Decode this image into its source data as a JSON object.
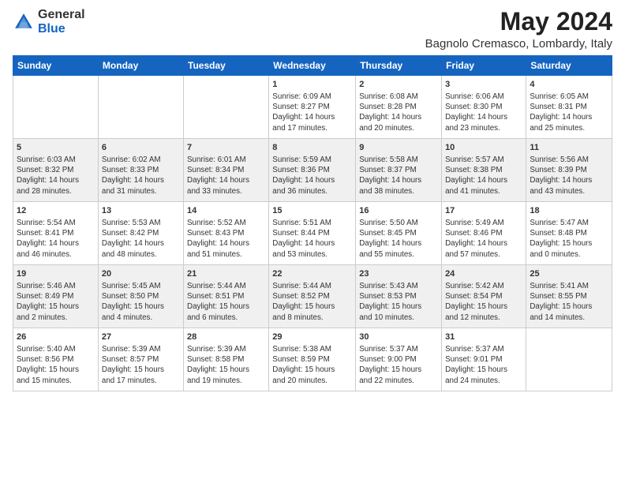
{
  "header": {
    "logo_general": "General",
    "logo_blue": "Blue",
    "month_title": "May 2024",
    "location": "Bagnolo Cremasco, Lombardy, Italy"
  },
  "days_of_week": [
    "Sunday",
    "Monday",
    "Tuesday",
    "Wednesday",
    "Thursday",
    "Friday",
    "Saturday"
  ],
  "weeks": [
    [
      {
        "num": "",
        "info": ""
      },
      {
        "num": "",
        "info": ""
      },
      {
        "num": "",
        "info": ""
      },
      {
        "num": "1",
        "info": "Sunrise: 6:09 AM\nSunset: 8:27 PM\nDaylight: 14 hours\nand 17 minutes."
      },
      {
        "num": "2",
        "info": "Sunrise: 6:08 AM\nSunset: 8:28 PM\nDaylight: 14 hours\nand 20 minutes."
      },
      {
        "num": "3",
        "info": "Sunrise: 6:06 AM\nSunset: 8:30 PM\nDaylight: 14 hours\nand 23 minutes."
      },
      {
        "num": "4",
        "info": "Sunrise: 6:05 AM\nSunset: 8:31 PM\nDaylight: 14 hours\nand 25 minutes."
      }
    ],
    [
      {
        "num": "5",
        "info": "Sunrise: 6:03 AM\nSunset: 8:32 PM\nDaylight: 14 hours\nand 28 minutes."
      },
      {
        "num": "6",
        "info": "Sunrise: 6:02 AM\nSunset: 8:33 PM\nDaylight: 14 hours\nand 31 minutes."
      },
      {
        "num": "7",
        "info": "Sunrise: 6:01 AM\nSunset: 8:34 PM\nDaylight: 14 hours\nand 33 minutes."
      },
      {
        "num": "8",
        "info": "Sunrise: 5:59 AM\nSunset: 8:36 PM\nDaylight: 14 hours\nand 36 minutes."
      },
      {
        "num": "9",
        "info": "Sunrise: 5:58 AM\nSunset: 8:37 PM\nDaylight: 14 hours\nand 38 minutes."
      },
      {
        "num": "10",
        "info": "Sunrise: 5:57 AM\nSunset: 8:38 PM\nDaylight: 14 hours\nand 41 minutes."
      },
      {
        "num": "11",
        "info": "Sunrise: 5:56 AM\nSunset: 8:39 PM\nDaylight: 14 hours\nand 43 minutes."
      }
    ],
    [
      {
        "num": "12",
        "info": "Sunrise: 5:54 AM\nSunset: 8:41 PM\nDaylight: 14 hours\nand 46 minutes."
      },
      {
        "num": "13",
        "info": "Sunrise: 5:53 AM\nSunset: 8:42 PM\nDaylight: 14 hours\nand 48 minutes."
      },
      {
        "num": "14",
        "info": "Sunrise: 5:52 AM\nSunset: 8:43 PM\nDaylight: 14 hours\nand 51 minutes."
      },
      {
        "num": "15",
        "info": "Sunrise: 5:51 AM\nSunset: 8:44 PM\nDaylight: 14 hours\nand 53 minutes."
      },
      {
        "num": "16",
        "info": "Sunrise: 5:50 AM\nSunset: 8:45 PM\nDaylight: 14 hours\nand 55 minutes."
      },
      {
        "num": "17",
        "info": "Sunrise: 5:49 AM\nSunset: 8:46 PM\nDaylight: 14 hours\nand 57 minutes."
      },
      {
        "num": "18",
        "info": "Sunrise: 5:47 AM\nSunset: 8:48 PM\nDaylight: 15 hours\nand 0 minutes."
      }
    ],
    [
      {
        "num": "19",
        "info": "Sunrise: 5:46 AM\nSunset: 8:49 PM\nDaylight: 15 hours\nand 2 minutes."
      },
      {
        "num": "20",
        "info": "Sunrise: 5:45 AM\nSunset: 8:50 PM\nDaylight: 15 hours\nand 4 minutes."
      },
      {
        "num": "21",
        "info": "Sunrise: 5:44 AM\nSunset: 8:51 PM\nDaylight: 15 hours\nand 6 minutes."
      },
      {
        "num": "22",
        "info": "Sunrise: 5:44 AM\nSunset: 8:52 PM\nDaylight: 15 hours\nand 8 minutes."
      },
      {
        "num": "23",
        "info": "Sunrise: 5:43 AM\nSunset: 8:53 PM\nDaylight: 15 hours\nand 10 minutes."
      },
      {
        "num": "24",
        "info": "Sunrise: 5:42 AM\nSunset: 8:54 PM\nDaylight: 15 hours\nand 12 minutes."
      },
      {
        "num": "25",
        "info": "Sunrise: 5:41 AM\nSunset: 8:55 PM\nDaylight: 15 hours\nand 14 minutes."
      }
    ],
    [
      {
        "num": "26",
        "info": "Sunrise: 5:40 AM\nSunset: 8:56 PM\nDaylight: 15 hours\nand 15 minutes."
      },
      {
        "num": "27",
        "info": "Sunrise: 5:39 AM\nSunset: 8:57 PM\nDaylight: 15 hours\nand 17 minutes."
      },
      {
        "num": "28",
        "info": "Sunrise: 5:39 AM\nSunset: 8:58 PM\nDaylight: 15 hours\nand 19 minutes."
      },
      {
        "num": "29",
        "info": "Sunrise: 5:38 AM\nSunset: 8:59 PM\nDaylight: 15 hours\nand 20 minutes."
      },
      {
        "num": "30",
        "info": "Sunrise: 5:37 AM\nSunset: 9:00 PM\nDaylight: 15 hours\nand 22 minutes."
      },
      {
        "num": "31",
        "info": "Sunrise: 5:37 AM\nSunset: 9:01 PM\nDaylight: 15 hours\nand 24 minutes."
      },
      {
        "num": "",
        "info": ""
      }
    ]
  ]
}
